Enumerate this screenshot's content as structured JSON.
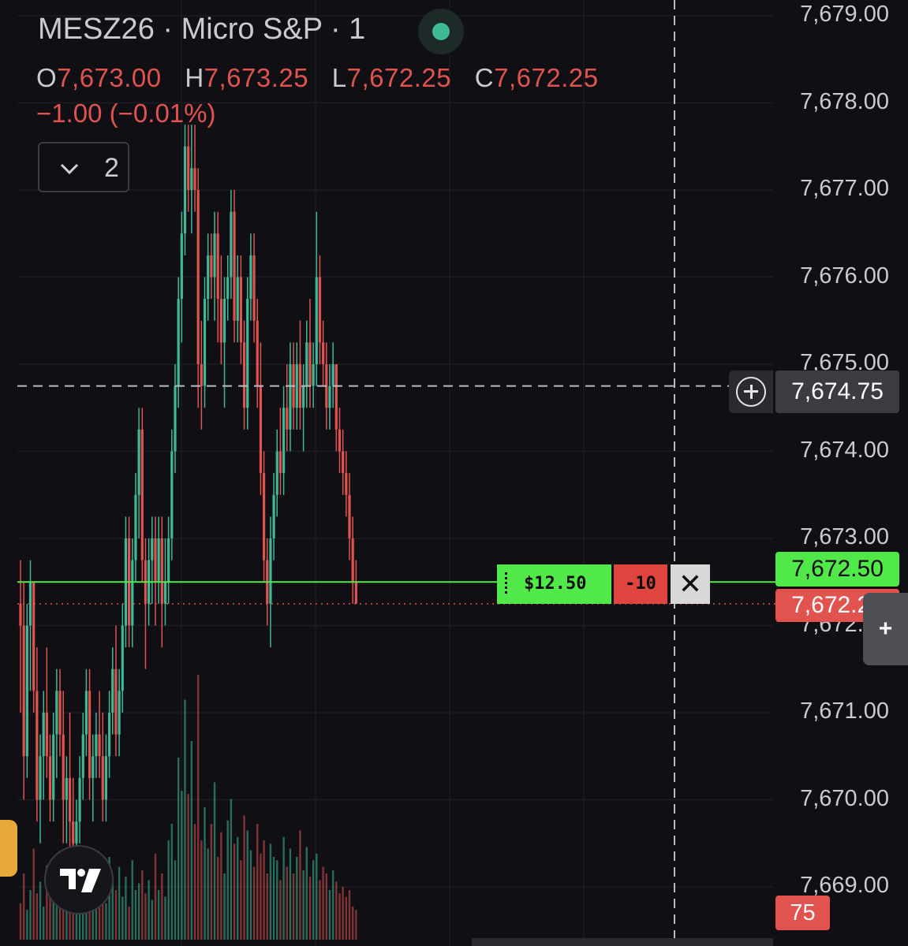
{
  "header": {
    "symbol_title": "MESZ26 · Micro S&P · 1",
    "ohlc": {
      "o_label": "O",
      "o_value": "7,673.00",
      "h_label": "H",
      "h_value": "7,673.25",
      "l_label": "L",
      "l_value": "7,672.25",
      "c_label": "C",
      "c_value": "7,672.25"
    },
    "change": "−1.00 (−0.01%)",
    "collapsed_indicators_count": "2"
  },
  "price_axis": {
    "labels": [
      "7,679.00",
      "7,678.00",
      "7,677.00",
      "7,676.00",
      "7,675.00",
      "7,674.00",
      "7,673.00",
      "7,672.00",
      "7,671.00",
      "7,670.00",
      "7,669.00"
    ],
    "crosshair_price": "7,674.75",
    "position_price": "7,672.50",
    "last_price": "7,672.25",
    "volume_tag": "75"
  },
  "position": {
    "pnl": "$12.50",
    "quantity": "-10",
    "close_symbol": "✕"
  },
  "colors": {
    "up": "#3fb995",
    "down": "#e0534f",
    "position_green": "#51e84a",
    "background": "#0f0f14"
  },
  "chart_data": {
    "type": "candlestick",
    "symbol": "MESZ26",
    "ylim": [
      7668.9,
      7679.2
    ],
    "candles": [
      [
        7672.25,
        7672.75,
        7671.0,
        7672.0
      ],
      [
        7672.0,
        7672.5,
        7670.0,
        7670.5
      ],
      [
        7670.5,
        7672.25,
        7670.25,
        7672.0
      ],
      [
        7672.0,
        7672.75,
        7671.25,
        7672.5
      ],
      [
        7672.5,
        7672.5,
        7671.0,
        7671.25
      ],
      [
        7671.25,
        7671.75,
        7669.75,
        7670.0
      ],
      [
        7670.0,
        7670.75,
        7669.5,
        7670.5
      ],
      [
        7670.5,
        7671.25,
        7670.0,
        7671.0
      ],
      [
        7671.0,
        7671.75,
        7670.25,
        7670.5
      ],
      [
        7670.5,
        7670.75,
        7669.75,
        7670.0
      ],
      [
        7670.0,
        7671.0,
        7669.75,
        7670.75
      ],
      [
        7670.75,
        7671.5,
        7670.25,
        7671.25
      ],
      [
        7671.25,
        7671.5,
        7670.5,
        7670.75
      ],
      [
        7670.75,
        7671.25,
        7669.5,
        7670.0
      ],
      [
        7670.0,
        7670.5,
        7669.5,
        7670.25
      ],
      [
        7670.25,
        7671.0,
        7669.25,
        7669.75
      ],
      [
        7669.75,
        7670.25,
        7669.0,
        7669.5
      ],
      [
        7669.5,
        7670.0,
        7669.25,
        7669.75
      ],
      [
        7669.75,
        7670.5,
        7669.5,
        7670.25
      ],
      [
        7670.25,
        7671.0,
        7670.0,
        7670.75
      ],
      [
        7670.75,
        7671.5,
        7670.5,
        7671.25
      ],
      [
        7671.25,
        7671.5,
        7670.0,
        7670.25
      ],
      [
        7670.25,
        7670.75,
        7669.75,
        7670.5
      ],
      [
        7670.5,
        7671.0,
        7670.25,
        7670.75
      ],
      [
        7670.75,
        7671.25,
        7670.25,
        7670.5
      ],
      [
        7670.5,
        7671.0,
        7669.75,
        7670.0
      ],
      [
        7670.0,
        7670.75,
        7669.75,
        7670.5
      ],
      [
        7670.5,
        7671.25,
        7670.25,
        7671.0
      ],
      [
        7671.0,
        7671.75,
        7670.75,
        7671.5
      ],
      [
        7671.5,
        7672.0,
        7670.5,
        7670.75
      ],
      [
        7670.75,
        7671.5,
        7670.5,
        7671.25
      ],
      [
        7671.25,
        7672.25,
        7671.0,
        7672.0
      ],
      [
        7672.0,
        7673.25,
        7671.75,
        7673.0
      ],
      [
        7673.0,
        7673.25,
        7671.75,
        7672.0
      ],
      [
        7672.0,
        7673.0,
        7671.75,
        7672.75
      ],
      [
        7672.75,
        7673.75,
        7672.5,
        7673.5
      ],
      [
        7673.5,
        7674.5,
        7673.0,
        7674.25
      ],
      [
        7674.25,
        7674.5,
        7672.5,
        7672.75
      ],
      [
        7672.75,
        7673.0,
        7671.5,
        7672.25
      ],
      [
        7672.25,
        7673.0,
        7672.0,
        7672.75
      ],
      [
        7672.75,
        7673.25,
        7672.25,
        7673.0
      ],
      [
        7673.0,
        7673.25,
        7672.0,
        7672.5
      ],
      [
        7672.5,
        7673.25,
        7672.25,
        7673.0
      ],
      [
        7673.0,
        7673.25,
        7671.75,
        7672.25
      ],
      [
        7672.25,
        7673.0,
        7672.0,
        7672.5
      ],
      [
        7672.5,
        7673.25,
        7672.25,
        7673.0
      ],
      [
        7673.0,
        7674.25,
        7672.75,
        7674.0
      ],
      [
        7674.0,
        7675.0,
        7673.75,
        7674.75
      ],
      [
        7674.75,
        7676.0,
        7674.5,
        7675.75
      ],
      [
        7675.75,
        7676.75,
        7675.25,
        7676.5
      ],
      [
        7676.5,
        7677.75,
        7676.25,
        7677.5
      ],
      [
        7677.5,
        7677.75,
        7676.75,
        7677.0
      ],
      [
        7677.0,
        7677.75,
        7676.5,
        7677.25
      ],
      [
        7677.25,
        7677.75,
        7676.75,
        7677.0
      ],
      [
        7677.0,
        7677.25,
        7674.5,
        7675.0
      ],
      [
        7675.0,
        7675.5,
        7674.25,
        7674.75
      ],
      [
        7674.75,
        7676.0,
        7674.5,
        7675.75
      ],
      [
        7675.75,
        7676.5,
        7675.5,
        7676.25
      ],
      [
        7676.25,
        7676.5,
        7675.75,
        7676.0
      ],
      [
        7676.0,
        7676.75,
        7675.5,
        7676.5
      ],
      [
        7676.5,
        7676.75,
        7675.25,
        7675.75
      ],
      [
        7675.75,
        7676.25,
        7675.0,
        7675.25
      ],
      [
        7675.25,
        7676.0,
        7674.5,
        7675.75
      ],
      [
        7675.75,
        7676.25,
        7675.5,
        7676.0
      ],
      [
        7676.0,
        7677.0,
        7675.75,
        7676.75
      ],
      [
        7676.75,
        7677.0,
        7675.25,
        7675.5
      ],
      [
        7675.5,
        7676.25,
        7675.25,
        7676.0
      ],
      [
        7676.0,
        7676.25,
        7675.0,
        7675.25
      ],
      [
        7675.25,
        7675.5,
        7674.25,
        7674.5
      ],
      [
        7674.5,
        7676.0,
        7674.25,
        7675.75
      ],
      [
        7675.75,
        7676.5,
        7675.5,
        7676.25
      ],
      [
        7676.25,
        7676.5,
        7675.25,
        7675.5
      ],
      [
        7675.5,
        7675.75,
        7674.5,
        7674.75
      ],
      [
        7674.75,
        7675.25,
        7673.5,
        7673.75
      ],
      [
        7673.75,
        7674.0,
        7672.5,
        7672.75
      ],
      [
        7672.75,
        7673.0,
        7672.0,
        7672.25
      ],
      [
        7672.25,
        7673.25,
        7671.75,
        7673.0
      ],
      [
        7673.0,
        7673.75,
        7672.75,
        7673.5
      ],
      [
        7673.5,
        7674.25,
        7673.25,
        7674.0
      ],
      [
        7674.0,
        7674.5,
        7673.5,
        7673.75
      ],
      [
        7673.75,
        7674.75,
        7673.5,
        7674.5
      ],
      [
        7674.5,
        7675.0,
        7674.0,
        7674.25
      ],
      [
        7674.25,
        7675.25,
        7674.0,
        7675.0
      ],
      [
        7675.0,
        7675.25,
        7674.25,
        7674.5
      ],
      [
        7674.5,
        7675.25,
        7674.25,
        7675.0
      ],
      [
        7675.0,
        7675.5,
        7674.25,
        7674.5
      ],
      [
        7674.5,
        7675.0,
        7674.0,
        7674.75
      ],
      [
        7674.75,
        7675.5,
        7674.5,
        7675.25
      ],
      [
        7675.25,
        7675.75,
        7674.5,
        7674.75
      ],
      [
        7674.75,
        7675.25,
        7674.5,
        7675.0
      ],
      [
        7675.0,
        7676.75,
        7674.75,
        7676.0
      ],
      [
        7676.0,
        7676.25,
        7675.0,
        7675.25
      ],
      [
        7675.25,
        7675.5,
        7674.75,
        7675.0
      ],
      [
        7675.0,
        7675.25,
        7674.25,
        7674.5
      ],
      [
        7674.5,
        7675.0,
        7674.25,
        7674.75
      ],
      [
        7674.75,
        7675.25,
        7674.5,
        7675.0
      ],
      [
        7675.0,
        7675.0,
        7674.0,
        7674.25
      ],
      [
        7674.25,
        7674.5,
        7673.75,
        7674.0
      ],
      [
        7674.0,
        7674.25,
        7673.5,
        7673.75
      ],
      [
        7673.75,
        7674.0,
        7673.25,
        7673.5
      ],
      [
        7673.5,
        7673.75,
        7672.75,
        7673.0
      ],
      [
        7673.0,
        7673.25,
        7672.25,
        7672.5
      ],
      [
        7672.5,
        7672.75,
        7672.25,
        7672.25
      ]
    ],
    "volume": [
      22,
      40,
      18,
      30,
      55,
      28,
      35,
      20,
      45,
      30,
      26,
      48,
      24,
      38,
      50,
      32,
      60,
      28,
      36,
      42,
      30,
      24,
      46,
      34,
      28,
      40,
      22,
      50,
      36,
      30,
      44,
      26,
      38,
      20,
      48,
      30,
      34,
      42,
      28,
      36,
      24,
      52,
      30,
      40,
      26,
      60,
      70,
      48,
      110,
      90,
      145,
      88,
      120,
      70,
      160,
      60,
      80,
      55,
      70,
      95,
      50,
      65,
      40,
      72,
      85,
      58,
      62,
      48,
      75,
      66,
      54,
      44,
      70,
      52,
      60,
      40,
      58,
      50,
      48,
      36,
      62,
      44,
      55,
      40,
      50,
      66,
      42,
      56,
      38,
      48,
      52,
      36,
      44,
      40,
      30,
      42,
      35,
      28,
      32,
      26,
      30,
      20,
      18
    ]
  }
}
